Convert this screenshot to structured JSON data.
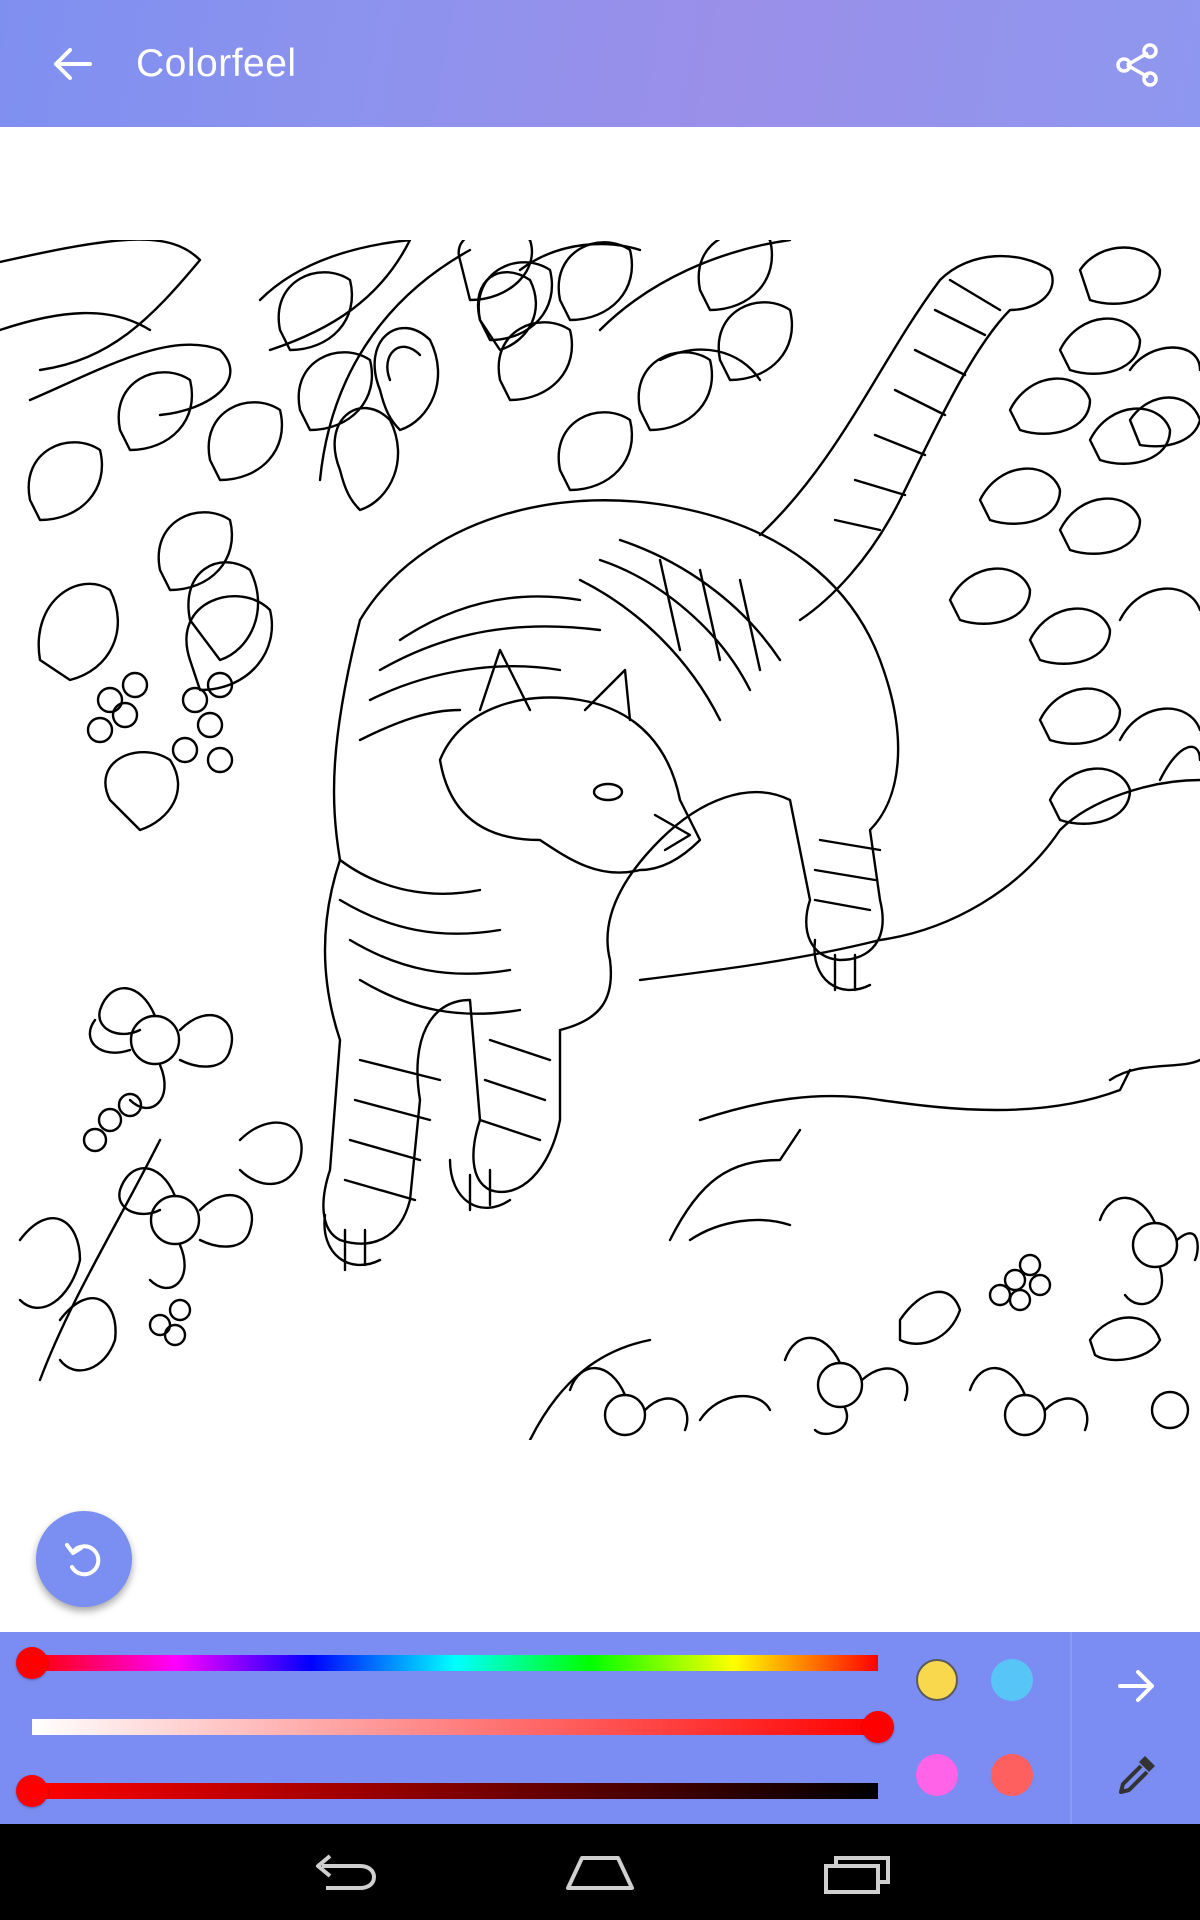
{
  "app": {
    "title": "Colorfeel"
  },
  "icons": {
    "back": "arrow-left-icon",
    "share": "share-icon",
    "undo": "undo-icon",
    "next": "arrow-right-icon",
    "picker": "eyedropper-icon",
    "nav_back": "nav-back-icon",
    "nav_home": "nav-home-icon",
    "nav_recents": "nav-recents-icon"
  },
  "palette": {
    "hue_level": 0.0,
    "saturation_level": 1.0,
    "brightness_level": 0.0,
    "swatches": [
      "#f9d84d",
      "#58c5f7",
      "#ff64e8",
      "#fe5f5f"
    ]
  },
  "colors": {
    "appbar": "#8c93ee",
    "panel": "#7b8cf3",
    "fab": "#7b8ff3"
  }
}
